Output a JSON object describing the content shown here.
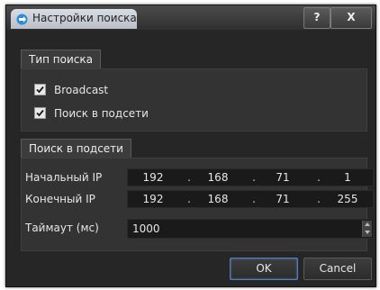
{
  "window": {
    "title": "Настройки поиска",
    "help_label": "?",
    "close_label": "X"
  },
  "search_type": {
    "tab_label": "Тип поиска",
    "options": [
      {
        "label": "Broadcast",
        "checked": true
      },
      {
        "label": "Поиск в подсети",
        "checked": true
      }
    ]
  },
  "subnet_search": {
    "tab_label": "Поиск в подсети",
    "start_ip": {
      "label": "Начальный IP",
      "octets": [
        "192",
        "168",
        "71",
        "1"
      ]
    },
    "end_ip": {
      "label": "Конечный IP",
      "octets": [
        "192",
        "168",
        "71",
        "255"
      ]
    },
    "timeout": {
      "label": "Таймаут (мс)",
      "value": "1000"
    }
  },
  "buttons": {
    "ok_label": "OK",
    "cancel_label": "Cancel"
  },
  "colors": {
    "dialog_bg": "#262626",
    "panel_bg": "#333333",
    "field_bg": "#1a1a1a",
    "focus_border": "#4f7fbf"
  },
  "icons": [
    "app-icon",
    "help-icon",
    "close-icon",
    "check-icon",
    "spin-up-icon",
    "spin-down-icon"
  ]
}
